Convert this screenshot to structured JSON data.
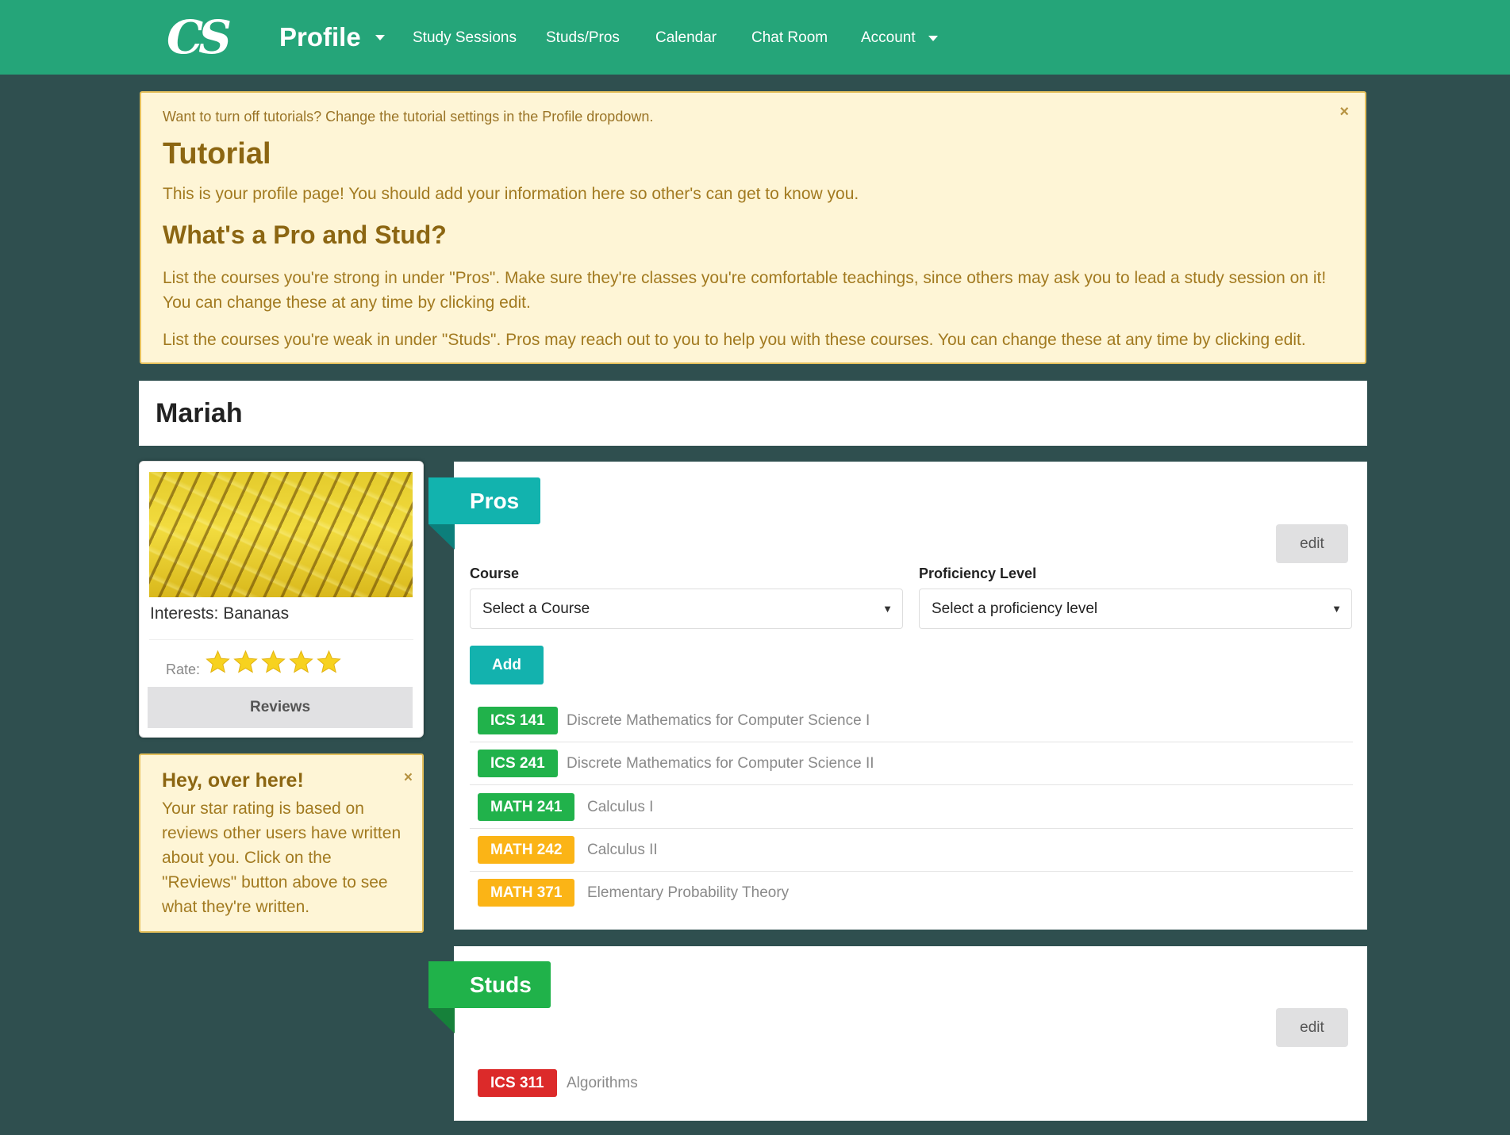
{
  "nav": {
    "logo": "CS",
    "brand": "Profile",
    "links": [
      "Study Sessions",
      "Studs/Pros",
      "Calendar",
      "Chat Room",
      "Account"
    ]
  },
  "tutorial": {
    "note": "Want to turn off tutorials? Change the tutorial settings in the Profile dropdown.",
    "title": "Tutorial",
    "intro": "This is your profile page! You should add your information here so other's can get to know you.",
    "subtitle": "What's a Pro and Stud?",
    "pros_text": "List the courses you're strong in under \"Pros\". Make sure they're classes you're comfortable teachings, since others may ask you to lead a study session on it! You can change these at any time by clicking edit.",
    "studs_text": "List the courses you're weak in under \"Studs\". Pros may reach out to you to help you with these courses. You can change these at any time by clicking edit.",
    "close": "×"
  },
  "profile": {
    "name": "Mariah",
    "interests": "Interests: Bananas",
    "rate_label": "Rate:",
    "rating": 5,
    "reviews_label": "Reviews"
  },
  "hint": {
    "title": "Hey, over here!",
    "text": "Your star rating is based on reviews other users have written about you. Click on the \"Reviews\" button above to see what they're written.",
    "close": "×"
  },
  "pros": {
    "title": "Pros",
    "edit_label": "edit",
    "course_label": "Course",
    "course_placeholder": "Select a Course",
    "level_label": "Proficiency Level",
    "level_placeholder": "Select a proficiency level",
    "add_label": "Add",
    "courses": [
      {
        "code": "ICS 141",
        "name": "Discrete Mathematics for Computer Science I",
        "color": "#21b24b"
      },
      {
        "code": "ICS 241",
        "name": "Discrete Mathematics for Computer Science II",
        "color": "#21b24b"
      },
      {
        "code": "MATH 241",
        "name": "Calculus I",
        "color": "#21b24b"
      },
      {
        "code": "MATH 242",
        "name": "Calculus II",
        "color": "#fbb416"
      },
      {
        "code": "MATH 371",
        "name": "Elementary Probability Theory",
        "color": "#fbb416"
      }
    ]
  },
  "studs": {
    "title": "Studs",
    "edit_label": "edit",
    "courses": [
      {
        "code": "ICS 311",
        "name": "Algorithms",
        "color": "#dc2a2a"
      }
    ]
  },
  "colors": {
    "nav": "#25a579",
    "background": "#2f4f4f",
    "pros_ribbon": "#12b3ae",
    "studs_ribbon": "#20b24a",
    "star": "#f7d21f"
  }
}
